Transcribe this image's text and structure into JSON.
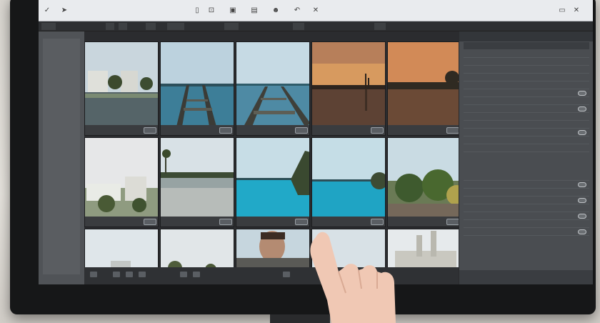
{
  "topbar": {
    "icons": [
      "back-icon",
      "share-icon",
      "folder-icon",
      "crop-icon",
      "layout-icon",
      "image-icon",
      "person-icon",
      "undo-icon",
      "close-icon",
      "window-min-icon",
      "window-close-icon"
    ]
  },
  "panel": {
    "row_count": 17
  },
  "colors": {
    "bezel": "#161718",
    "screen": "#3c3e41",
    "panel": "#4a4d51",
    "topbar": "#e9ebee",
    "accent_water": "#21a9c8"
  }
}
